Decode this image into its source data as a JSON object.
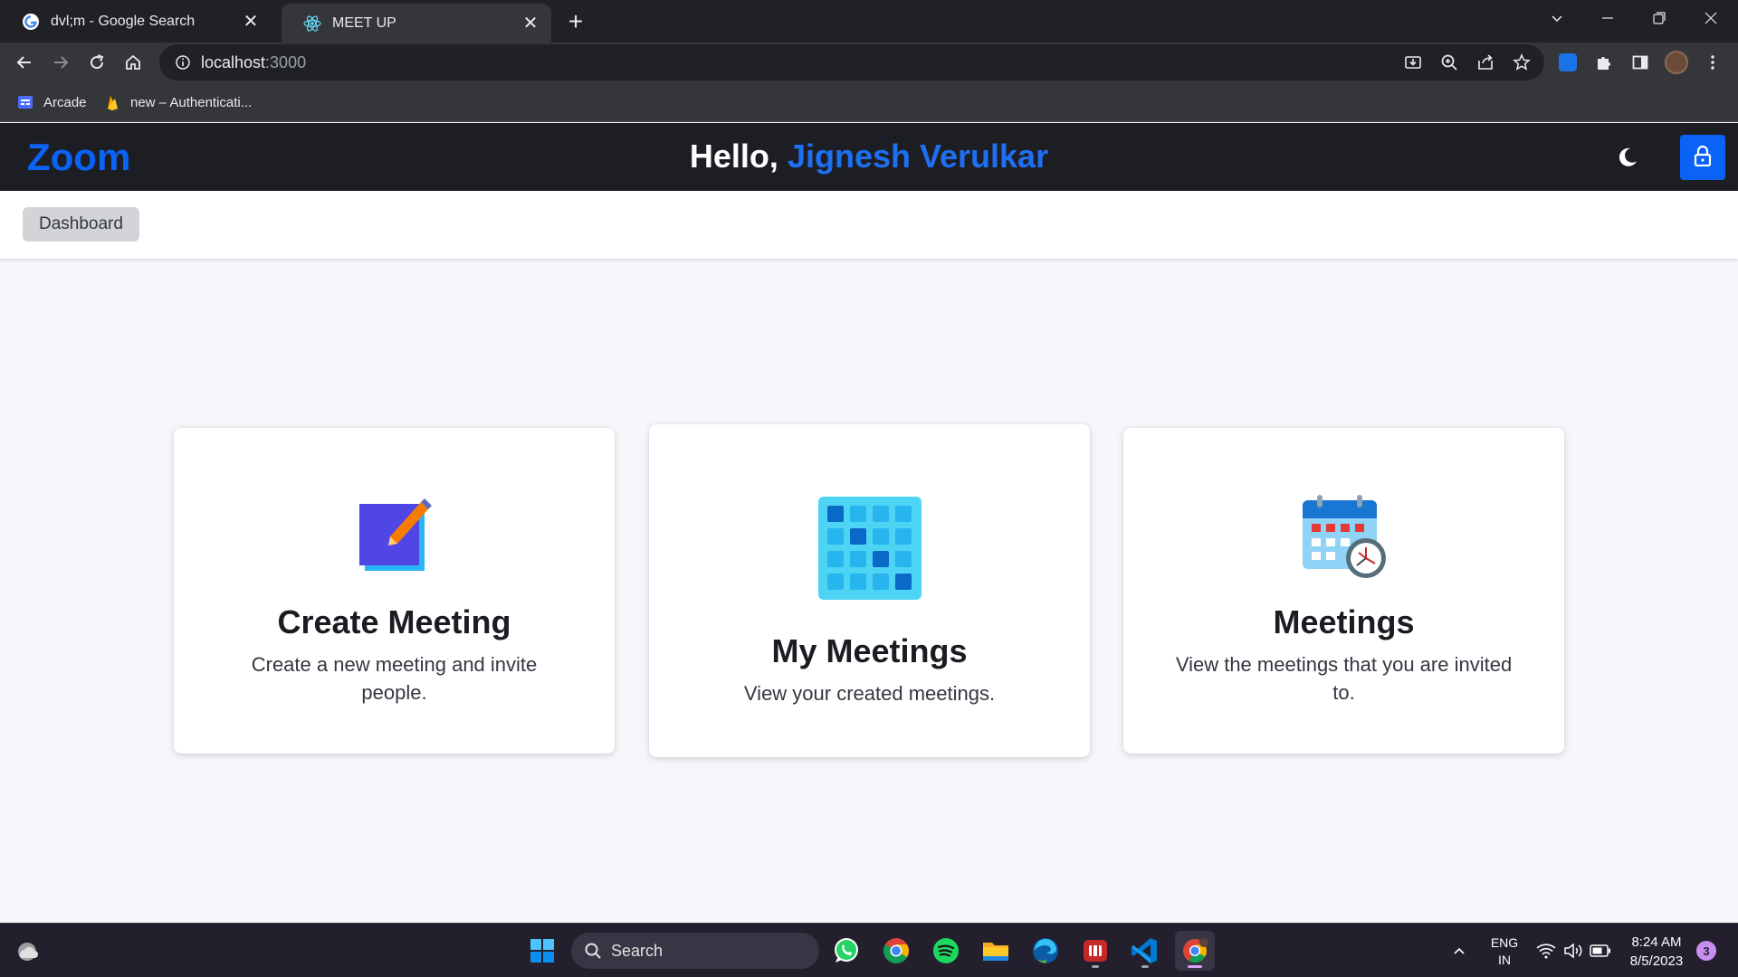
{
  "browser": {
    "tabs": [
      {
        "title": "dvl;m - Google Search",
        "icon": "google-icon",
        "active": false
      },
      {
        "title": "MEET UP",
        "icon": "react-icon",
        "active": true
      }
    ],
    "new_tab_label": "+",
    "url_host": "localhost",
    "url_port": ":3000",
    "bookmarks": [
      {
        "label": "Arcade",
        "icon": "arcade-icon"
      },
      {
        "label": "new – Authenticati...",
        "icon": "firebase-icon"
      }
    ]
  },
  "app": {
    "logo": "Zoom",
    "greeting_prefix": "Hello, ",
    "user_name": "Jignesh Verulkar",
    "accent_color": "#0b63f6",
    "breadcrumb": [
      "Dashboard"
    ]
  },
  "cards": [
    {
      "title": "Create Meeting",
      "description": "Create a new meeting and invite people.",
      "icon": "create-meeting-icon"
    },
    {
      "title": "My Meetings",
      "description": "View your created meetings.",
      "icon": "grid-calendar-icon"
    },
    {
      "title": "Meetings",
      "description": "View the meetings that you are invited to.",
      "icon": "calendar-clock-icon"
    }
  ],
  "taskbar": {
    "search_placeholder": "Search",
    "language_line1": "ENG",
    "language_line2": "IN",
    "time": "8:24 AM",
    "date": "8/5/2023",
    "notification_count": "3",
    "apps": [
      "whatsapp-icon",
      "chrome-icon",
      "spotify-icon",
      "file-explorer-icon",
      "edge-icon",
      "winrar-icon",
      "vscode-icon",
      "chrome-profile-icon"
    ]
  }
}
